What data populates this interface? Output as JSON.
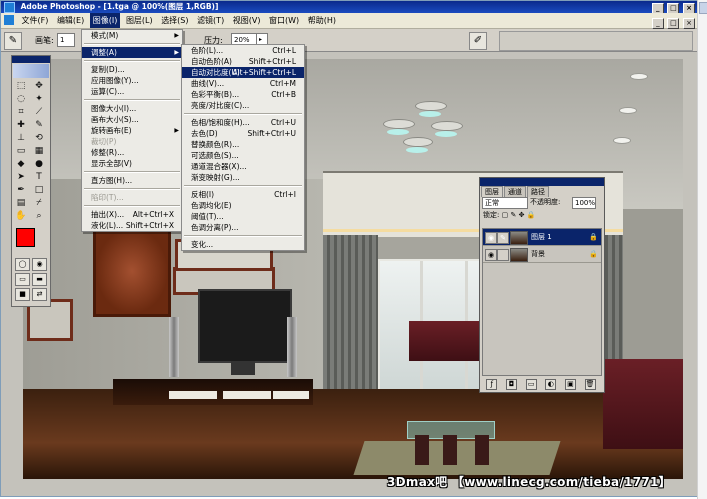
{
  "window": {
    "title": "Adobe Photoshop - [1.tga @ 100%(图层 1,RGB)]",
    "buttons": [
      "_",
      "□",
      "×"
    ]
  },
  "menubar": {
    "items": [
      "文件(F)",
      "编辑(E)",
      "图像(I)",
      "图层(L)",
      "选择(S)",
      "滤镜(T)",
      "视图(V)",
      "窗口(W)",
      "帮助(H)"
    ],
    "open_item": "图像(I)"
  },
  "options": {
    "brush_label": "画笔:",
    "brush_size": "1",
    "flow_label": "压力:",
    "flow_value": "20%"
  },
  "image_menu": [
    {
      "label": "模式(M)",
      "submenu": true
    },
    {
      "sep": true
    },
    {
      "label": "调整(A)",
      "submenu": true,
      "selected": true
    },
    {
      "sep": true
    },
    {
      "label": "复制(D)..."
    },
    {
      "label": "应用图像(Y)..."
    },
    {
      "label": "运算(C)..."
    },
    {
      "sep": true
    },
    {
      "label": "图像大小(I)..."
    },
    {
      "label": "画布大小(S)..."
    },
    {
      "label": "旋转画布(E)",
      "submenu": true
    },
    {
      "label": "裁切(P)",
      "disabled": true
    },
    {
      "label": "修整(R)..."
    },
    {
      "label": "显示全部(V)"
    },
    {
      "sep": true
    },
    {
      "label": "直方图(H)..."
    },
    {
      "sep": true
    },
    {
      "label": "陷印(T)...",
      "disabled": true
    },
    {
      "sep": true
    },
    {
      "label": "抽出(X)...",
      "shortcut": "Alt+Ctrl+X"
    },
    {
      "label": "液化(L)...",
      "shortcut": "Shift+Ctrl+X"
    }
  ],
  "adjust_menu": [
    {
      "label": "色阶(L)...",
      "shortcut": "Ctrl+L"
    },
    {
      "label": "自动色阶(A)",
      "shortcut": "Shift+Ctrl+L"
    },
    {
      "label": "自动对比度(U)",
      "shortcut": "Alt+Shift+Ctrl+L",
      "selected": true
    },
    {
      "label": "曲线(V)...",
      "shortcut": "Ctrl+M"
    },
    {
      "label": "色彩平衡(B)...",
      "shortcut": "Ctrl+B"
    },
    {
      "label": "亮度/对比度(C)..."
    },
    {
      "sep": true
    },
    {
      "label": "色相/饱和度(H)...",
      "shortcut": "Ctrl+U"
    },
    {
      "label": "去色(D)",
      "shortcut": "Shift+Ctrl+U"
    },
    {
      "label": "替换颜色(R)..."
    },
    {
      "label": "可选颜色(S)..."
    },
    {
      "label": "通道混合器(X)..."
    },
    {
      "label": "渐变映射(G)..."
    },
    {
      "sep": true
    },
    {
      "label": "反相(I)",
      "shortcut": "Ctrl+I"
    },
    {
      "label": "色调均化(E)"
    },
    {
      "label": "阈值(T)..."
    },
    {
      "label": "色调分离(P)..."
    },
    {
      "sep": true
    },
    {
      "label": "变化..."
    }
  ],
  "layers_panel": {
    "tabs": [
      "图层",
      "通道",
      "路径"
    ],
    "blend_mode": "正常",
    "opacity_label": "不透明度:",
    "opacity_value": "100%",
    "lock_label": "锁定:",
    "layers": [
      {
        "name": "图层 1",
        "active": true
      },
      {
        "name": "背景",
        "active": false
      }
    ]
  },
  "colors": {
    "foreground": "#ff0000",
    "background": "#ffffff",
    "title_bar": "#0a246a"
  },
  "watermark": "3Dmax吧 【www.linecg.com/tieba/1771】"
}
